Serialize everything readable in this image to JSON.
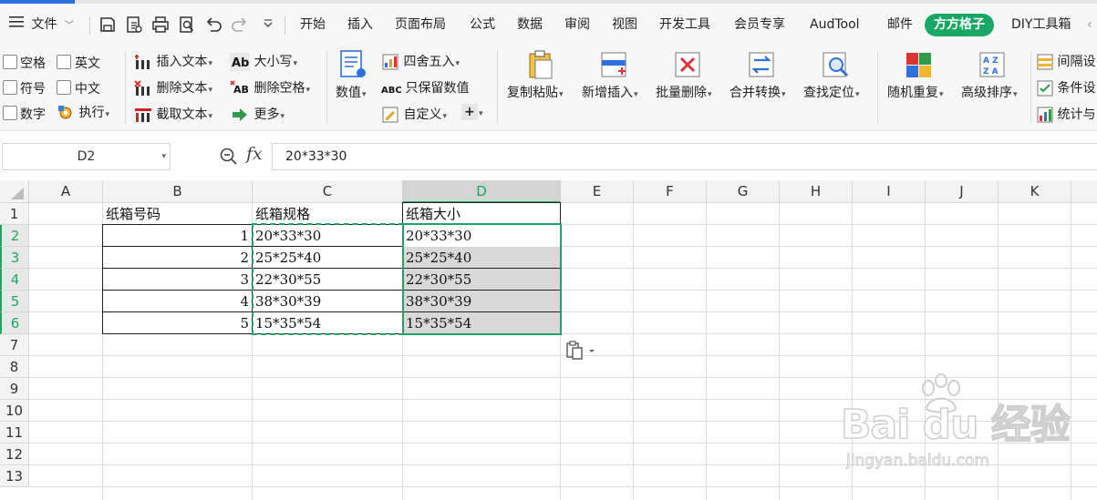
{
  "menu": {
    "file_label": "文件",
    "tabs": [
      "开始",
      "插入",
      "页面布局",
      "公式",
      "数据",
      "审阅",
      "视图",
      "开发工具",
      "会员专享",
      "AudTool",
      "邮件",
      "方方格子",
      "DIY工具箱"
    ],
    "active_tab": "方方格子"
  },
  "ribbon": {
    "checks": [
      "空格",
      "英文",
      "符号",
      "中文",
      "数字"
    ],
    "exec_label": "执行",
    "text_buttons": [
      "插入文本",
      "删除文本",
      "截取文本"
    ],
    "case_buttons": [
      "大小写",
      "删除空格",
      "更多"
    ],
    "value_label": "数值",
    "number_buttons": [
      "四舍五入",
      "只保留数值",
      "自定义"
    ],
    "big_buttons": [
      "复制粘贴",
      "新增插入",
      "批量删除",
      "合并转换",
      "查找定位",
      "随机重复",
      "高级排序"
    ],
    "right_buttons": [
      "间隔设",
      "条件设",
      "统计与"
    ]
  },
  "formula_bar": {
    "name_box": "D2",
    "fx_label": "fx",
    "content": "20*33*30"
  },
  "sheet": {
    "columns": [
      "A",
      "B",
      "C",
      "D",
      "E",
      "F",
      "G",
      "H",
      "I",
      "J",
      "K"
    ],
    "selected_column": "D",
    "rows": [
      "1",
      "2",
      "3",
      "4",
      "5",
      "6",
      "7",
      "8",
      "9",
      "10",
      "11",
      "12",
      "13"
    ],
    "selected_rows": [
      "2",
      "3",
      "4",
      "5",
      "6"
    ],
    "header": {
      "b": "纸箱号码",
      "c": "纸箱规格",
      "d": "纸箱大小"
    },
    "data": [
      {
        "b": "1",
        "c": "20*33*30",
        "d": "20*33*30"
      },
      {
        "b": "2",
        "c": "25*25*40",
        "d": "25*25*40"
      },
      {
        "b": "3",
        "c": "22*30*55",
        "d": "22*30*55"
      },
      {
        "b": "4",
        "c": "38*30*39",
        "d": "38*30*39"
      },
      {
        "b": "5",
        "c": "15*35*54",
        "d": "15*35*54"
      }
    ]
  },
  "watermark": {
    "logo": "Bai du 经验",
    "url": "jingyan.baidu.com"
  },
  "colors": {
    "accent": "#1aa766",
    "selection_fill": "#d9d9d9"
  }
}
